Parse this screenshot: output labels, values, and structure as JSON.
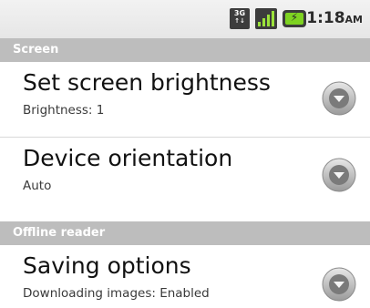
{
  "status_bar": {
    "network_type": "3G",
    "network_sub": "↑↓",
    "signal_icon": "signal-icon",
    "battery_icon": "battery-icon",
    "time": "1:18",
    "ampm": "AM"
  },
  "sections": [
    {
      "header": "Screen",
      "items": [
        {
          "title": "Set screen brightness",
          "summary": "Brightness: 1"
        },
        {
          "title": "Device orientation",
          "summary": "Auto"
        }
      ]
    },
    {
      "header": "Offline reader",
      "items": [
        {
          "title": "Saving options",
          "summary": "Downloading images: Enabled"
        }
      ]
    }
  ]
}
